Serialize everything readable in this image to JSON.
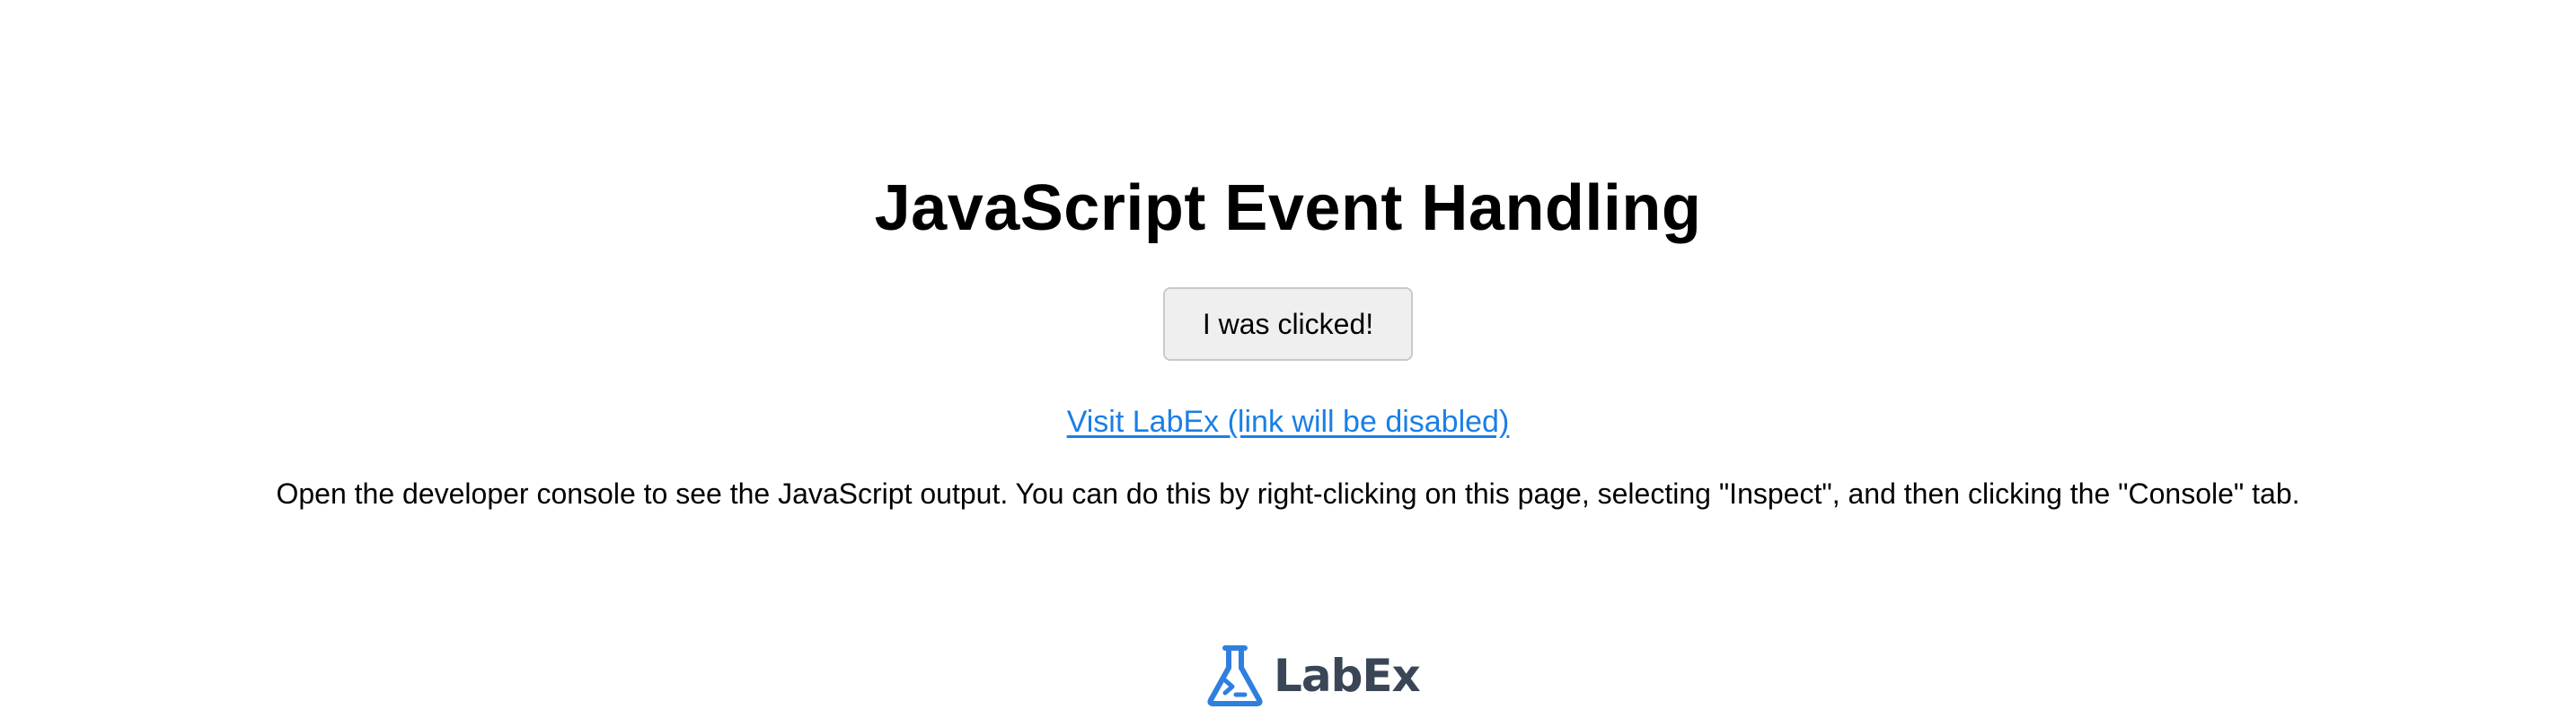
{
  "page": {
    "title": "JavaScript Event Handling"
  },
  "button": {
    "label": "I was clicked!"
  },
  "link": {
    "label": "Visit LabEx (link will be disabled)"
  },
  "instructions": {
    "text": "Open the developer console to see the JavaScript output. You can do this by right-clicking on this page, selecting \"Inspect\", and then clicking the \"Console\" tab."
  },
  "logo": {
    "icon": "flask-terminal-icon",
    "text": "LabEx",
    "icon_color": "#2f7fe0",
    "text_color": "#3a4656"
  },
  "colors": {
    "link": "#1a7fe6",
    "button_bg": "#efefef",
    "button_border": "#c9c9c9"
  }
}
